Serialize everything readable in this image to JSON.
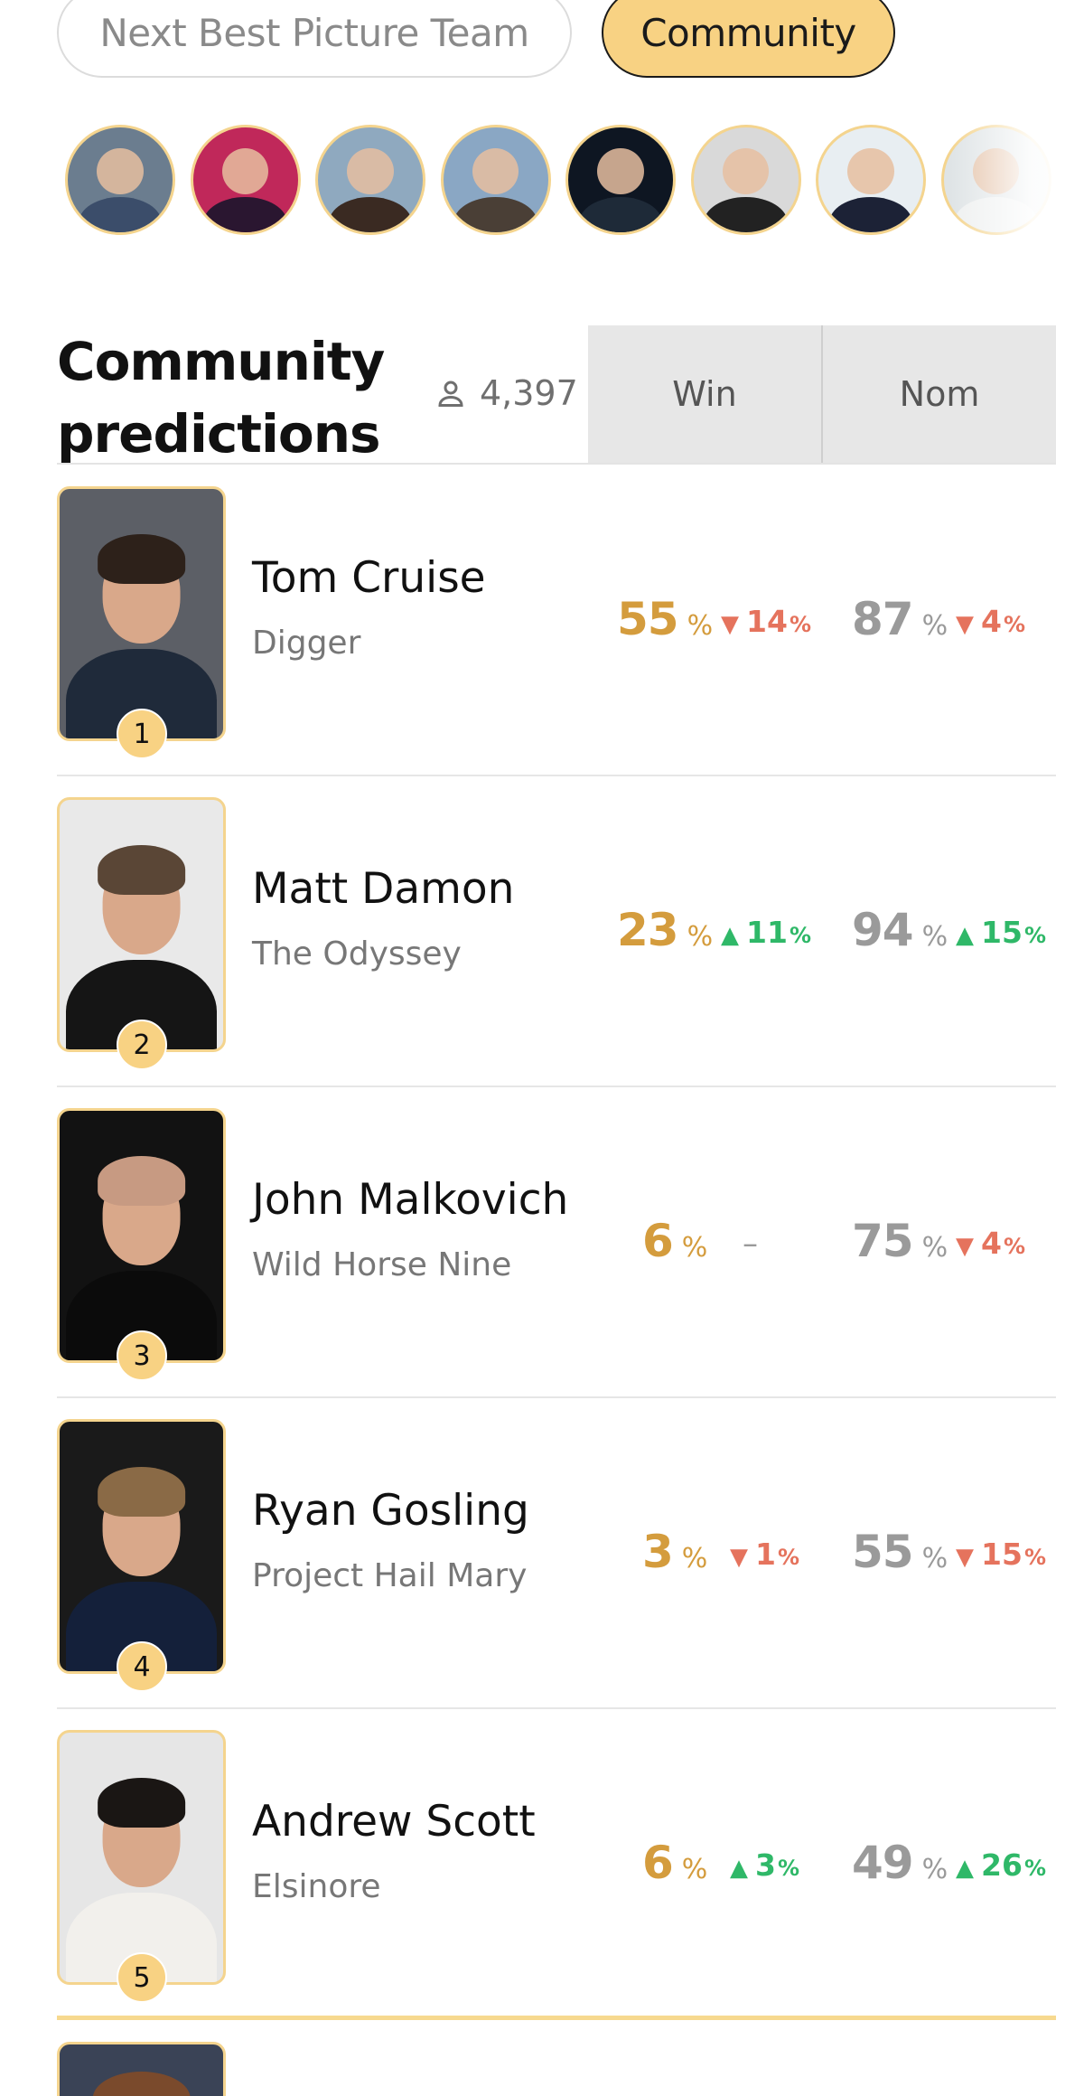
{
  "tabs": [
    {
      "label": "Next Best Picture Team",
      "active": false
    },
    {
      "label": "Community",
      "active": true
    }
  ],
  "avatars": [
    {
      "name": "avatar-1",
      "bg": "#6b7d8f",
      "body": "#3b4d6a"
    },
    {
      "name": "avatar-2",
      "bg": "#c0285a",
      "body": "#2a1630"
    },
    {
      "name": "avatar-3",
      "bg": "#8fa9bf",
      "body": "#3a2a22"
    },
    {
      "name": "avatar-4",
      "bg": "#8aa7c4",
      "body": "#4a3f36"
    },
    {
      "name": "avatar-5",
      "bg": "#0e1622",
      "body": "#1e2a38"
    },
    {
      "name": "avatar-6",
      "bg": "#d9d9d9",
      "body": "#222222"
    },
    {
      "name": "avatar-7",
      "bg": "#e8eef2",
      "body": "#1c2236"
    },
    {
      "name": "avatar-8",
      "bg": "#dfe4e6",
      "body": "#eef0f0"
    }
  ],
  "header": {
    "title_line1": "Community",
    "title_line2": "predictions",
    "user_count": "4,397",
    "col_win": "Win",
    "col_nom": "Nom"
  },
  "rows": [
    {
      "rank": "1",
      "name": "Tom Cruise",
      "film": "Digger",
      "win": "55",
      "win_delta": "14",
      "win_dir": "down",
      "nom": "87",
      "nom_delta": "4",
      "nom_dir": "down",
      "bg": "#5c5f66",
      "hair": "#2d211a",
      "body": "#1f2a3a"
    },
    {
      "rank": "2",
      "name": "Matt Damon",
      "film": "The Odyssey",
      "win": "23",
      "win_delta": "11",
      "win_dir": "up",
      "nom": "94",
      "nom_delta": "15",
      "nom_dir": "up",
      "bg": "#e9e9e9",
      "hair": "#5a4636",
      "body": "#151515"
    },
    {
      "rank": "3",
      "name": "John Malkovich",
      "film": "Wild Horse Nine",
      "win": "6",
      "win_delta": "–",
      "win_dir": "none",
      "nom": "75",
      "nom_delta": "4",
      "nom_dir": "down",
      "bg": "#121212",
      "hair": "#c79a82",
      "body": "#0b0b0b"
    },
    {
      "rank": "4",
      "name": "Ryan Gosling",
      "film": "Project Hail Mary",
      "win": "3",
      "win_delta": "1",
      "win_dir": "down",
      "nom": "55",
      "nom_delta": "15",
      "nom_dir": "down",
      "bg": "#1a1a1a",
      "hair": "#8a6a46",
      "body": "#14203a"
    },
    {
      "rank": "5",
      "name": "Andrew Scott",
      "film": "Elsinore",
      "win": "6",
      "win_delta": "3",
      "win_dir": "up",
      "nom": "49",
      "nom_delta": "26",
      "nom_dir": "up",
      "bg": "#e6e6e6",
      "hair": "#1a1614",
      "body": "#f2f0ec"
    }
  ],
  "percent_symbol": "%",
  "arrows": {
    "up": "▲",
    "down": "▼"
  }
}
